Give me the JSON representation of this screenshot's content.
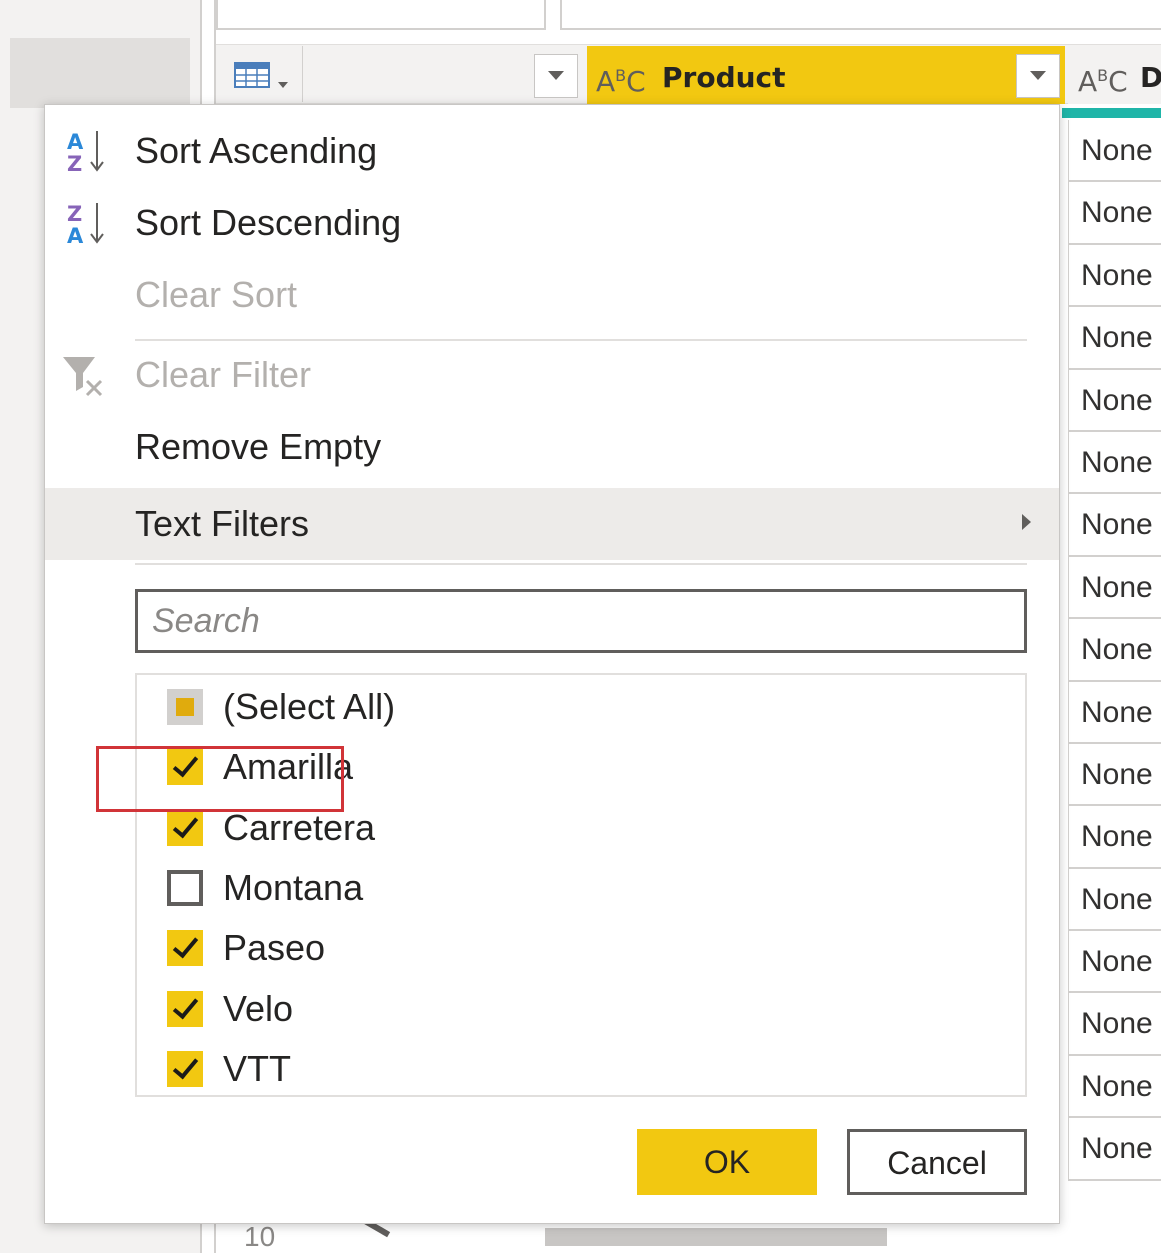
{
  "grid": {
    "product_header_label": "Product",
    "column_type_icon": "abc-text-type-icon",
    "next_column_letter": "D",
    "none_label": "None",
    "none_rows": [
      "None",
      "None",
      "None",
      "None",
      "None",
      "None",
      "None",
      "None",
      "None",
      "None",
      "None",
      "None",
      "None",
      "None",
      "None",
      "None",
      "None"
    ],
    "bottom_row_text": "10"
  },
  "menu": {
    "sort_ascending": "Sort Ascending",
    "sort_descending": "Sort Descending",
    "clear_sort": "Clear Sort",
    "clear_filter": "Clear Filter",
    "remove_empty": "Remove Empty",
    "text_filters": "Text Filters",
    "search_placeholder": "Search",
    "items": [
      {
        "label": "(Select All)",
        "state": "partial"
      },
      {
        "label": "Amarilla",
        "state": "checked"
      },
      {
        "label": "Carretera",
        "state": "checked"
      },
      {
        "label": "Montana",
        "state": "unchecked"
      },
      {
        "label": "Paseo",
        "state": "checked"
      },
      {
        "label": "Velo",
        "state": "checked"
      },
      {
        "label": "VTT",
        "state": "checked"
      }
    ],
    "ok_label": "OK",
    "cancel_label": "Cancel"
  },
  "colors": {
    "accent": "#f2c811",
    "highlight_border": "#d13438",
    "teal": "#1fb5a8"
  }
}
